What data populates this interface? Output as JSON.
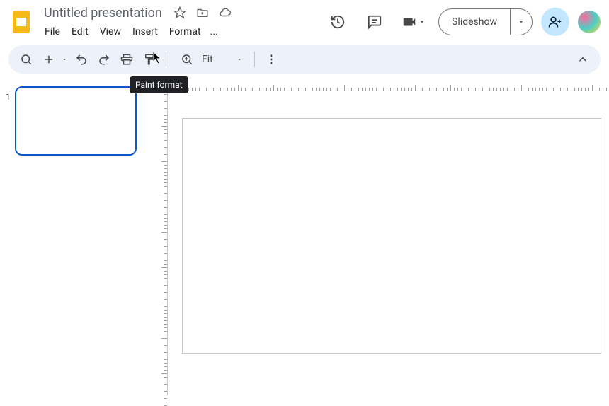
{
  "header": {
    "doc_title": "Untitled presentation",
    "star_icon": "star",
    "move_icon": "move-to-folder",
    "cloud_icon": "cloud-saved"
  },
  "menubar": {
    "items": [
      "File",
      "Edit",
      "View",
      "Insert",
      "Format"
    ],
    "more": "..."
  },
  "header_right": {
    "history_icon": "history",
    "comments_icon": "comments",
    "meet_icon": "video-meet",
    "slideshow_label": "Slideshow",
    "share_icon": "person-add"
  },
  "toolbar": {
    "search_icon": "search",
    "new_icon": "plus",
    "undo_icon": "undo",
    "redo_icon": "redo",
    "print_icon": "print",
    "paint_icon": "paint-format",
    "zoom_icon": "zoom",
    "zoom_text": "Fit",
    "more_icon": "more-vert",
    "collapse_icon": "chevron-up"
  },
  "tooltip": {
    "text": "Paint format"
  },
  "slides": {
    "panel": [
      {
        "number": "1"
      }
    ]
  }
}
